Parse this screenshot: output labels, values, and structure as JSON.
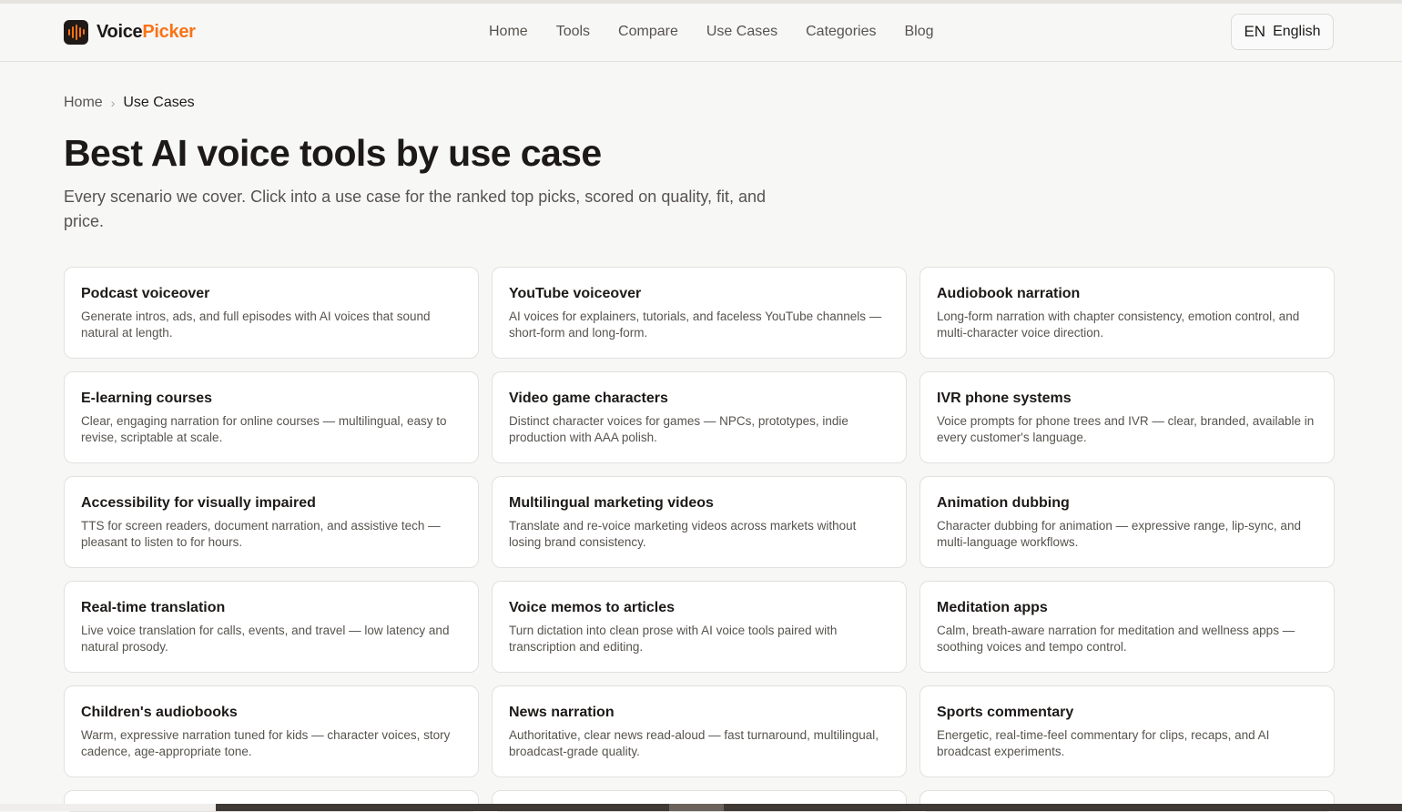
{
  "brand": {
    "name_part1": "Voice",
    "name_part2": "Picker",
    "accent": "#f97316",
    "logo_icon": "waveform-icon"
  },
  "nav": {
    "links": [
      "Home",
      "Tools",
      "Compare",
      "Use Cases",
      "Categories",
      "Blog"
    ],
    "language": {
      "code": "EN",
      "label": "English"
    }
  },
  "breadcrumb": {
    "home": "Home",
    "separator": "›",
    "current": "Use Cases"
  },
  "page": {
    "title": "Best AI voice tools by use case",
    "subtitle": "Every scenario we cover. Click into a use case for the ranked top picks, scored on quality, fit, and price."
  },
  "use_cases": [
    {
      "title": "Podcast voiceover",
      "desc": "Generate intros, ads, and full episodes with AI voices that sound natural at length."
    },
    {
      "title": "YouTube voiceover",
      "desc": "AI voices for explainers, tutorials, and faceless YouTube channels — short-form and long-form."
    },
    {
      "title": "Audiobook narration",
      "desc": "Long-form narration with chapter consistency, emotion control, and multi-character voice direction."
    },
    {
      "title": "E-learning courses",
      "desc": "Clear, engaging narration for online courses — multilingual, easy to revise, scriptable at scale."
    },
    {
      "title": "Video game characters",
      "desc": "Distinct character voices for games — NPCs, prototypes, indie production with AAA polish."
    },
    {
      "title": "IVR phone systems",
      "desc": "Voice prompts for phone trees and IVR — clear, branded, available in every customer's language."
    },
    {
      "title": "Accessibility for visually impaired",
      "desc": "TTS for screen readers, document narration, and assistive tech — pleasant to listen to for hours."
    },
    {
      "title": "Multilingual marketing videos",
      "desc": "Translate and re-voice marketing videos across markets without losing brand consistency."
    },
    {
      "title": "Animation dubbing",
      "desc": "Character dubbing for animation — expressive range, lip-sync, and multi-language workflows."
    },
    {
      "title": "Real-time translation",
      "desc": "Live voice translation for calls, events, and travel — low latency and natural prosody."
    },
    {
      "title": "Voice memos to articles",
      "desc": "Turn dictation into clean prose with AI voice tools paired with transcription and editing."
    },
    {
      "title": "Meditation apps",
      "desc": "Calm, breath-aware narration for meditation and wellness apps — soothing voices and tempo control."
    },
    {
      "title": "Children's audiobooks",
      "desc": "Warm, expressive narration tuned for kids — character voices, story cadence, age-appropriate tone."
    },
    {
      "title": "News narration",
      "desc": "Authoritative, clear news read-aloud — fast turnaround, multilingual, broadcast-grade quality."
    },
    {
      "title": "Sports commentary",
      "desc": "Energetic, real-time-feel commentary for clips, recaps, and AI broadcast experiments."
    }
  ]
}
